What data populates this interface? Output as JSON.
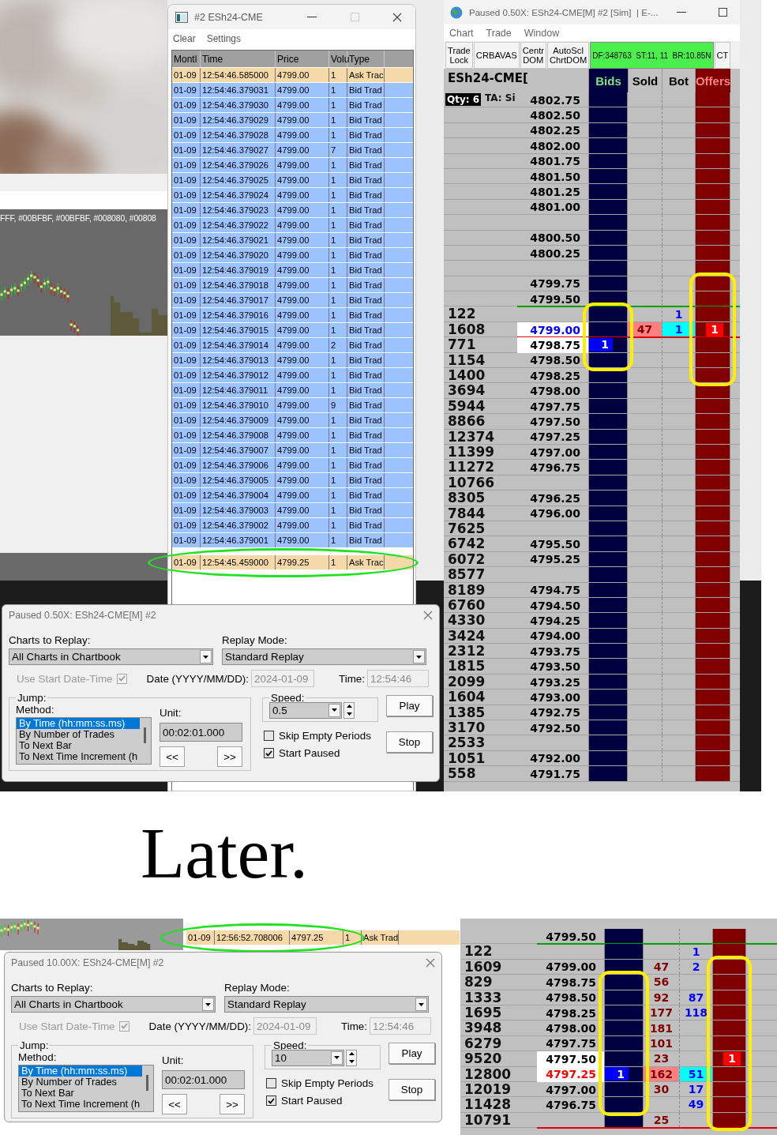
{
  "top_screenshot": {
    "chart_window": {
      "legend": "FFF, #00BFBF, #00BFBF, #008080, #00808"
    },
    "time_and_sales": {
      "title": "#2 ESh24-CME",
      "menu": [
        "Clear",
        "Settings"
      ],
      "columns": [
        "Montl",
        "Time",
        "Price",
        "Volu",
        "Type"
      ],
      "rows": [
        {
          "month": "01-09",
          "time": "12:54:46.585000",
          "price": "4799.00",
          "volume": "1",
          "type": "Ask Trac",
          "color": "#f6d9a9",
          "highlighted": false
        },
        {
          "month": "01-09",
          "time": "12:54:46.379031",
          "price": "4799.00",
          "volume": "1",
          "type": "Bid Trad",
          "color": "#9cc3ff",
          "highlighted": false
        },
        {
          "month": "01-09",
          "time": "12:54:46.379030",
          "price": "4799.00",
          "volume": "1",
          "type": "Bid Trad",
          "color": "#9cc3ff",
          "highlighted": false
        },
        {
          "month": "01-09",
          "time": "12:54:46.379029",
          "price": "4799.00",
          "volume": "1",
          "type": "Bid Trad",
          "color": "#9cc3ff",
          "highlighted": false
        },
        {
          "month": "01-09",
          "time": "12:54:46.379028",
          "price": "4799.00",
          "volume": "1",
          "type": "Bid Trad",
          "color": "#9cc3ff",
          "highlighted": false
        },
        {
          "month": "01-09",
          "time": "12:54:46.379027",
          "price": "4799.00",
          "volume": "7",
          "type": "Bid Trad",
          "color": "#9cc3ff",
          "highlighted": false
        },
        {
          "month": "01-09",
          "time": "12:54:46.379026",
          "price": "4799.00",
          "volume": "1",
          "type": "Bid Trad",
          "color": "#9cc3ff",
          "highlighted": false
        },
        {
          "month": "01-09",
          "time": "12:54:46.379025",
          "price": "4799.00",
          "volume": "1",
          "type": "Bid Trad",
          "color": "#9cc3ff",
          "highlighted": false
        },
        {
          "month": "01-09",
          "time": "12:54:46.379024",
          "price": "4799.00",
          "volume": "1",
          "type": "Bid Trad",
          "color": "#9cc3ff",
          "highlighted": false
        },
        {
          "month": "01-09",
          "time": "12:54:46.379023",
          "price": "4799.00",
          "volume": "1",
          "type": "Bid Trad",
          "color": "#9cc3ff",
          "highlighted": false
        },
        {
          "month": "01-09",
          "time": "12:54:46.379022",
          "price": "4799.00",
          "volume": "1",
          "type": "Bid Trad",
          "color": "#9cc3ff",
          "highlighted": false
        },
        {
          "month": "01-09",
          "time": "12:54:46.379021",
          "price": "4799.00",
          "volume": "1",
          "type": "Bid Trad",
          "color": "#9cc3ff",
          "highlighted": false
        },
        {
          "month": "01-09",
          "time": "12:54:46.379020",
          "price": "4799.00",
          "volume": "1",
          "type": "Bid Trad",
          "color": "#9cc3ff",
          "highlighted": false
        },
        {
          "month": "01-09",
          "time": "12:54:46.379019",
          "price": "4799.00",
          "volume": "1",
          "type": "Bid Trad",
          "color": "#9cc3ff",
          "highlighted": false
        },
        {
          "month": "01-09",
          "time": "12:54:46.379018",
          "price": "4799.00",
          "volume": "1",
          "type": "Bid Trad",
          "color": "#9cc3ff",
          "highlighted": false
        },
        {
          "month": "01-09",
          "time": "12:54:46.379017",
          "price": "4799.00",
          "volume": "1",
          "type": "Bid Trad",
          "color": "#9cc3ff",
          "highlighted": false
        },
        {
          "month": "01-09",
          "time": "12:54:46.379016",
          "price": "4799.00",
          "volume": "1",
          "type": "Bid Trad",
          "color": "#9cc3ff",
          "highlighted": false
        },
        {
          "month": "01-09",
          "time": "12:54:46.379015",
          "price": "4799.00",
          "volume": "1",
          "type": "Bid Trad",
          "color": "#9cc3ff",
          "highlighted": false
        },
        {
          "month": "01-09",
          "time": "12:54:46.379014",
          "price": "4799.00",
          "volume": "2",
          "type": "Bid Trad",
          "color": "#9cc3ff",
          "highlighted": false
        },
        {
          "month": "01-09",
          "time": "12:54:46.379013",
          "price": "4799.00",
          "volume": "1",
          "type": "Bid Trad",
          "color": "#9cc3ff",
          "highlighted": false
        },
        {
          "month": "01-09",
          "time": "12:54:46.379012",
          "price": "4799.00",
          "volume": "1",
          "type": "Bid Trad",
          "color": "#9cc3ff",
          "highlighted": false
        },
        {
          "month": "01-09",
          "time": "12:54:46.379011",
          "price": "4799.00",
          "volume": "1",
          "type": "Bid Trad",
          "color": "#9cc3ff",
          "highlighted": false
        },
        {
          "month": "01-09",
          "time": "12:54:46.379010",
          "price": "4799.00",
          "volume": "9",
          "type": "Bid Trad",
          "color": "#9cc3ff",
          "highlighted": false
        },
        {
          "month": "01-09",
          "time": "12:54:46.379009",
          "price": "4799.00",
          "volume": "1",
          "type": "Bid Trad",
          "color": "#9cc3ff",
          "highlighted": false
        },
        {
          "month": "01-09",
          "time": "12:54:46.379008",
          "price": "4799.00",
          "volume": "1",
          "type": "Bid Trad",
          "color": "#9cc3ff",
          "highlighted": false
        },
        {
          "month": "01-09",
          "time": "12:54:46.379007",
          "price": "4799.00",
          "volume": "1",
          "type": "Bid Trad",
          "color": "#9cc3ff",
          "highlighted": false
        },
        {
          "month": "01-09",
          "time": "12:54:46.379006",
          "price": "4799.00",
          "volume": "1",
          "type": "Bid Trad",
          "color": "#9cc3ff",
          "highlighted": false
        },
        {
          "month": "01-09",
          "time": "12:54:46.379005",
          "price": "4799.00",
          "volume": "1",
          "type": "Bid Trad",
          "color": "#9cc3ff",
          "highlighted": false
        },
        {
          "month": "01-09",
          "time": "12:54:46.379004",
          "price": "4799.00",
          "volume": "1",
          "type": "Bid Trad",
          "color": "#9cc3ff",
          "highlighted": false
        },
        {
          "month": "01-09",
          "time": "12:54:46.379003",
          "price": "4799.00",
          "volume": "1",
          "type": "Bid Trad",
          "color": "#9cc3ff",
          "highlighted": false
        },
        {
          "month": "01-09",
          "time": "12:54:46.379002",
          "price": "4799.00",
          "volume": "1",
          "type": "Bid Trad",
          "color": "#9cc3ff",
          "highlighted": false
        },
        {
          "month": "01-09",
          "time": "12:54:46.379001",
          "price": "4799.00",
          "volume": "1",
          "type": "Bid Trad",
          "color": "#9cc3ff",
          "highlighted": false
        },
        {
          "month": "01-09",
          "time": "12:54:45.459000",
          "price": "4799.25",
          "volume": "1",
          "type": "Ask Trac",
          "color": "#f6d9a9",
          "highlighted": true
        }
      ]
    },
    "dom": {
      "title": "Paused 0.50X: ESh24-CME[M] #2 [Sim]  | E-...",
      "menu": [
        "Chart",
        "Trade",
        "Window"
      ],
      "toolbar": [
        {
          "label": "Trade Lock",
          "kind": "button"
        },
        {
          "label": "CRBAVAS",
          "kind": "button"
        },
        {
          "label": "Centr DOM",
          "kind": "button"
        },
        {
          "label": "AutoScl ChrtDOM",
          "kind": "button"
        },
        {
          "label": "DF:348763  ST:11, 11  BR:10.85N",
          "kind": "status"
        },
        {
          "label": "CT",
          "kind": "button"
        }
      ],
      "symbol": "ESh24-CME[",
      "qty": "Qty: 6",
      "ta": "TA: Si",
      "columns": [
        "Bids",
        "Sold",
        "Bot",
        "Offers"
      ],
      "rows": [
        {
          "price": "4802.75",
          "inside": false
        },
        {
          "price": "4802.50",
          "inside": false
        },
        {
          "price": "4802.25",
          "inside": false
        },
        {
          "price": "4802.00",
          "inside": false
        },
        {
          "price": "4801.75",
          "inside": false
        },
        {
          "price": "4801.50",
          "inside": false
        },
        {
          "price": "4801.25",
          "inside": false
        },
        {
          "price": "4801.00",
          "inside": false
        },
        {
          "inside": false
        },
        {
          "price": "4800.50",
          "inside": false
        },
        {
          "price": "4800.25",
          "inside": false
        },
        {
          "inside": false
        },
        {
          "price": "4799.75",
          "inside": false,
          "offers_outlined": true
        },
        {
          "price": "4799.50",
          "inside": false,
          "level_line": {
            "color": "#00a000"
          },
          "offers_outlined": true
        },
        {
          "volume": "122",
          "inside": false,
          "bot": {
            "text": "1",
            "highlight": false
          },
          "bids_outlined": true,
          "offers_outlined": true
        },
        {
          "volume": "1608",
          "price": "4799.00",
          "inside": true,
          "color": "#0000ff",
          "sold": {
            "text": "47",
            "highlight": true
          },
          "bot": {
            "text": "1",
            "highlight": true
          },
          "offers": "1",
          "level_line": {
            "color": "#e00000"
          },
          "bids_outlined": true,
          "offers_outlined": true
        },
        {
          "volume": "771",
          "price": "4798.75",
          "inside": true,
          "bids": "1",
          "bids_outlined": true,
          "offers_outlined": true
        },
        {
          "volume": "1154",
          "price": "4798.50",
          "inside": false,
          "bids_outlined": true,
          "offers_outlined": true
        },
        {
          "volume": "1400",
          "price": "4798.25",
          "inside": false,
          "offers_outlined": true
        },
        {
          "volume": "3694",
          "price": "4798.00",
          "inside": false
        },
        {
          "volume": "5944",
          "price": "4797.75",
          "inside": false
        },
        {
          "volume": "8866",
          "price": "4797.50",
          "inside": false
        },
        {
          "volume": "12374",
          "price": "4797.25",
          "inside": false
        },
        {
          "volume": "11399",
          "price": "4797.00",
          "inside": false
        },
        {
          "volume": "11272",
          "price": "4796.75",
          "inside": false
        },
        {
          "volume": "10766",
          "inside": false
        },
        {
          "volume": "8305",
          "price": "4796.25",
          "inside": false
        },
        {
          "volume": "7844",
          "price": "4796.00",
          "inside": false
        },
        {
          "volume": "7625",
          "inside": false
        },
        {
          "volume": "6742",
          "price": "4795.50",
          "inside": false
        },
        {
          "volume": "6072",
          "price": "4795.25",
          "inside": false
        },
        {
          "volume": "8577",
          "inside": false
        },
        {
          "volume": "8189",
          "price": "4794.75",
          "inside": false
        },
        {
          "volume": "6760",
          "price": "4794.50",
          "inside": false
        },
        {
          "volume": "4330",
          "price": "4794.25",
          "inside": false
        },
        {
          "volume": "3424",
          "price": "4794.00",
          "inside": false
        },
        {
          "volume": "2312",
          "price": "4793.75",
          "inside": false
        },
        {
          "volume": "1815",
          "price": "4793.50",
          "inside": false
        },
        {
          "volume": "2099",
          "price": "4793.25",
          "inside": false
        },
        {
          "volume": "1604",
          "price": "4793.00",
          "inside": false
        },
        {
          "volume": "1385",
          "price": "4792.75",
          "inside": false
        },
        {
          "volume": "3170",
          "price": "4792.50",
          "inside": false
        },
        {
          "volume": "2533",
          "inside": false
        },
        {
          "volume": "1051",
          "price": "4792.00",
          "inside": false
        },
        {
          "volume": "558",
          "price": "4791.75",
          "inside": false
        }
      ]
    },
    "replay_dialog": {
      "title": "Paused 0.50X: ESh24-CME[M] #2",
      "charts_label": "Charts to Replay:",
      "charts_value": "All Charts in Chartbook",
      "mode_label": "Replay Mode:",
      "mode_value": "Standard Replay",
      "use_start": {
        "label": "Use Start Date-Time",
        "checked": true,
        "disabled": true
      },
      "date": {
        "label": "Date (YYYY/MM/DD):",
        "value": "2024-01-09",
        "disabled": true
      },
      "time": {
        "label": "Time:",
        "value": "12:54:46",
        "disabled": true
      },
      "jump_label": "Jump:",
      "method_label": "Method:",
      "methods": [
        {
          "label": "By Time (hh:mm:ss.ms)",
          "selected": true
        },
        {
          "label": "By Number of Trades",
          "selected": false
        },
        {
          "label": "To Next Bar",
          "selected": false
        },
        {
          "label": "To Next Time Increment (h",
          "selected": false
        }
      ],
      "unit_label": "Unit:",
      "unit_value": "00:02:01.000",
      "back_button": "<<",
      "forward_button": ">>",
      "speed_label": "Speed:",
      "speed_value": "0.5",
      "options": [
        {
          "label": "Skip Empty Periods",
          "checked": false
        },
        {
          "label": "Start Paused",
          "checked": true
        }
      ],
      "buttons": [
        "Play",
        "Stop"
      ]
    }
  },
  "caption": "Later.",
  "bottom_screenshot": {
    "time_and_sales": {
      "rows": [
        {
          "month": "01-09",
          "time": "12:56:52.708006",
          "price": "4797.25",
          "volume": "1",
          "type": "Ask Trad",
          "color": "#f6d9a9",
          "highlighted": true
        }
      ]
    },
    "replay_dialog": {
      "title": "Paused 10.00X: ESh24-CME[M] #2",
      "charts_label": "Charts to Replay:",
      "charts_value": "All Charts in Chartbook",
      "mode_label": "Replay Mode:",
      "mode_value": "Standard Replay",
      "use_start": {
        "label": "Use Start Date-Time",
        "checked": true,
        "disabled": true
      },
      "date": {
        "label": "Date (YYYY/MM/DD):",
        "value": "2024-01-09",
        "disabled": true
      },
      "time": {
        "label": "Time:",
        "value": "12:54:46",
        "disabled": true
      },
      "jump_label": "Jump:",
      "method_label": "Method:",
      "methods": [
        {
          "label": "By Time (hh:mm:ss.ms)",
          "selected": true
        },
        {
          "label": "By Number of Trades",
          "selected": false
        },
        {
          "label": "To Next Bar",
          "selected": false
        },
        {
          "label": "To Next Time Increment (h",
          "selected": false
        }
      ],
      "unit_label": "Unit:",
      "unit_value": "00:02:01.000",
      "back_button": "<<",
      "forward_button": ">>",
      "speed_label": "Speed:",
      "speed_value": "10",
      "options": [
        {
          "label": "Skip Empty Periods",
          "checked": false
        },
        {
          "label": "Start Paused",
          "checked": true
        }
      ],
      "buttons": [
        "Play",
        "Stop"
      ]
    },
    "dom": {
      "rows": [
        {
          "price": "4799.50",
          "inside": false,
          "level_line": {
            "color": "#00a000"
          }
        },
        {
          "volume": "122",
          "inside": false,
          "bot": {
            "text": "1",
            "highlight": false
          }
        },
        {
          "volume": "1609",
          "price": "4799.00",
          "inside": false,
          "sold": {
            "text": "47",
            "highlight": false
          },
          "bot": {
            "text": "2",
            "highlight": false
          },
          "offers_outlined": true
        },
        {
          "volume": "829",
          "price": "4798.75",
          "inside": false,
          "sold": {
            "text": "56",
            "highlight": false
          },
          "bids_outlined": true,
          "offers_outlined": true
        },
        {
          "volume": "1333",
          "price": "4798.50",
          "inside": false,
          "sold": {
            "text": "92",
            "highlight": false
          },
          "bot": {
            "text": "87",
            "highlight": false
          },
          "bids_outlined": true,
          "offers_outlined": true
        },
        {
          "volume": "1695",
          "price": "4798.25",
          "inside": false,
          "sold": {
            "text": "177",
            "highlight": false
          },
          "bot": {
            "text": "118",
            "highlight": false
          },
          "bids_outlined": true,
          "offers_outlined": true
        },
        {
          "volume": "3948",
          "price": "4798.00",
          "inside": false,
          "sold": {
            "text": "181",
            "highlight": false
          },
          "bids_outlined": true,
          "offers_outlined": true
        },
        {
          "volume": "6279",
          "price": "4797.75",
          "inside": false,
          "sold": {
            "text": "101",
            "highlight": false
          },
          "bids_outlined": true,
          "offers_outlined": true
        },
        {
          "volume": "9520",
          "price": "4797.50",
          "inside": true,
          "sold": {
            "text": "23",
            "highlight": false
          },
          "offers": "1",
          "bids_outlined": true,
          "offers_outlined": true
        },
        {
          "volume": "12800",
          "price": "4797.25",
          "inside": true,
          "color": "#ff0000",
          "bids": "1",
          "sold": {
            "text": "162",
            "highlight": true
          },
          "bot": {
            "text": "51",
            "highlight": true
          },
          "bids_outlined": true,
          "offers_outlined": true
        },
        {
          "volume": "12019",
          "price": "4797.00",
          "inside": false,
          "sold": {
            "text": "30",
            "highlight": false
          },
          "bot": {
            "text": "17",
            "highlight": false
          },
          "bids_outlined": true,
          "offers_outlined": true
        },
        {
          "volume": "11428",
          "price": "4796.75",
          "inside": false,
          "bot": {
            "text": "49",
            "highlight": false
          },
          "bids_outlined": true,
          "offers_outlined": true
        },
        {
          "volume": "10791",
          "inside": false,
          "sold": {
            "text": "25",
            "highlight": false
          },
          "level_line": {
            "color": "#e00000"
          },
          "offers_outlined": true
        }
      ]
    }
  }
}
